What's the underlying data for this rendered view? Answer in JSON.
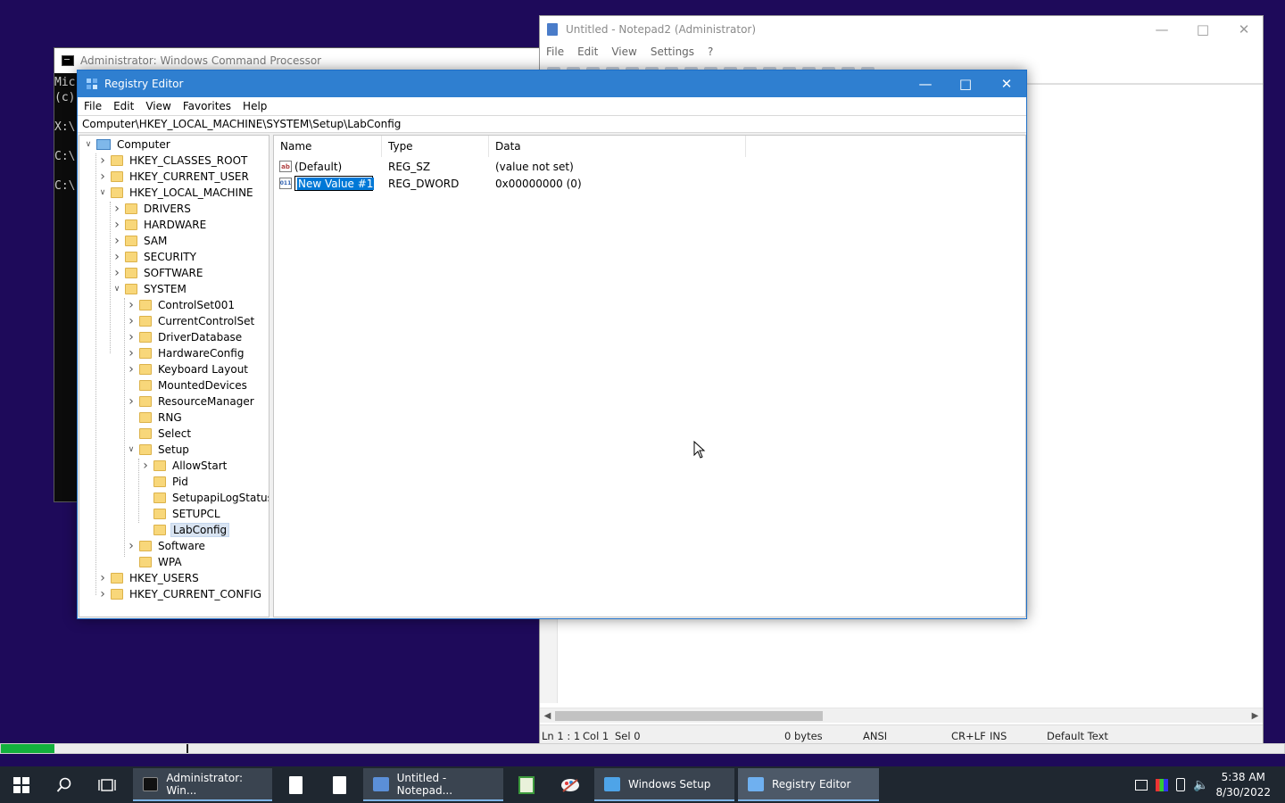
{
  "cmd": {
    "title": "Administrator: Windows Command Processor",
    "lines": [
      "Mic",
      "(c)",
      "",
      "X:\\",
      "",
      "C:\\",
      "",
      "C:\\"
    ]
  },
  "notepad": {
    "title": "Untitled - Notepad2 (Administrator)",
    "menu": [
      "File",
      "Edit",
      "View",
      "Settings",
      "?"
    ],
    "status": {
      "position": "Ln 1 : 1",
      "col": "Col 1",
      "sel": "Sel 0",
      "size": "0 bytes",
      "encoding": "ANSI",
      "eol": "CR+LF",
      "ins": "INS",
      "scheme": "Default Text"
    }
  },
  "regedit": {
    "title": "Registry Editor",
    "menu": [
      "File",
      "Edit",
      "View",
      "Favorites",
      "Help"
    ],
    "address": "Computer\\HKEY_LOCAL_MACHINE\\SYSTEM\\Setup\\LabConfig",
    "tree": [
      {
        "label": "Computer",
        "expand": "open",
        "icon": "computer-icon"
      },
      {
        "label": "HKEY_CLASSES_ROOT",
        "expand": "closed"
      },
      {
        "label": "HKEY_CURRENT_USER",
        "expand": "closed"
      },
      {
        "label": "HKEY_LOCAL_MACHINE",
        "expand": "open"
      },
      {
        "label": "DRIVERS",
        "expand": "closed"
      },
      {
        "label": "HARDWARE",
        "expand": "closed"
      },
      {
        "label": "SAM",
        "expand": "closed"
      },
      {
        "label": "SECURITY",
        "expand": "closed"
      },
      {
        "label": "SOFTWARE",
        "expand": "closed"
      },
      {
        "label": "SYSTEM",
        "expand": "open"
      },
      {
        "label": "ControlSet001",
        "expand": "closed"
      },
      {
        "label": "CurrentControlSet",
        "expand": "closed"
      },
      {
        "label": "DriverDatabase",
        "expand": "closed"
      },
      {
        "label": "HardwareConfig",
        "expand": "closed"
      },
      {
        "label": "Keyboard Layout",
        "expand": "closed"
      },
      {
        "label": "MountedDevices",
        "expand": "none"
      },
      {
        "label": "ResourceManager",
        "expand": "closed"
      },
      {
        "label": "RNG",
        "expand": "none"
      },
      {
        "label": "Select",
        "expand": "none"
      },
      {
        "label": "Setup",
        "expand": "open"
      },
      {
        "label": "AllowStart",
        "expand": "closed"
      },
      {
        "label": "Pid",
        "expand": "none"
      },
      {
        "label": "SetupapiLogStatus",
        "expand": "none"
      },
      {
        "label": "SETUPCL",
        "expand": "none"
      },
      {
        "label": "LabConfig",
        "expand": "none",
        "selected": true
      },
      {
        "label": "Software",
        "expand": "closed"
      },
      {
        "label": "WPA",
        "expand": "none"
      },
      {
        "label": "HKEY_USERS",
        "expand": "closed"
      },
      {
        "label": "HKEY_CURRENT_CONFIG",
        "expand": "closed"
      }
    ],
    "columns": {
      "name": "Name",
      "type": "Type",
      "data": "Data"
    },
    "values": [
      {
        "name": "(Default)",
        "type": "REG_SZ",
        "data": "(value not set)",
        "icon": "string-value-icon"
      },
      {
        "name": "New Value #1",
        "type": "REG_DWORD",
        "data": "0x00000000 (0)",
        "icon": "dword-value-icon",
        "editing": true
      }
    ]
  },
  "progress": {
    "fraction": 0.042
  },
  "taskbar": {
    "buttons": [
      {
        "label": "Administrator: Win...",
        "icon": "cmd-icon"
      },
      {
        "label": "",
        "icon": "file-icon"
      },
      {
        "label": "",
        "icon": "file-icon"
      },
      {
        "label": "Untitled - Notepad...",
        "icon": "notepad-icon"
      },
      {
        "label": "",
        "icon": "notepad-green-icon"
      },
      {
        "label": "",
        "icon": "paint-icon"
      },
      {
        "label": "Windows Setup",
        "icon": "setup-icon"
      },
      {
        "label": "Registry Editor",
        "icon": "regedit-icon"
      }
    ],
    "time": "5:38 AM",
    "date": "8/30/2022"
  },
  "colors": {
    "desktop": "#1e0a5a",
    "title_active": "#2f7fd0",
    "selection": "#0078d7",
    "progress": "#13b03d"
  }
}
